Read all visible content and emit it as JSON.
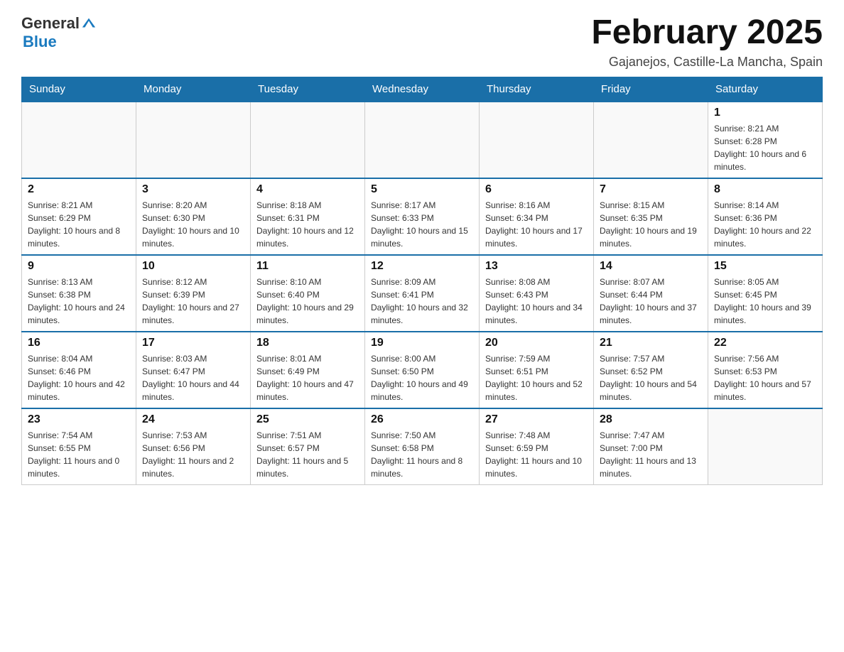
{
  "header": {
    "logo_general": "General",
    "logo_blue": "Blue",
    "month_title": "February 2025",
    "location": "Gajanejos, Castille-La Mancha, Spain"
  },
  "days_of_week": [
    "Sunday",
    "Monday",
    "Tuesday",
    "Wednesday",
    "Thursday",
    "Friday",
    "Saturday"
  ],
  "weeks": [
    {
      "days": [
        {
          "date": "",
          "info": ""
        },
        {
          "date": "",
          "info": ""
        },
        {
          "date": "",
          "info": ""
        },
        {
          "date": "",
          "info": ""
        },
        {
          "date": "",
          "info": ""
        },
        {
          "date": "",
          "info": ""
        },
        {
          "date": "1",
          "info": "Sunrise: 8:21 AM\nSunset: 6:28 PM\nDaylight: 10 hours and 6 minutes."
        }
      ]
    },
    {
      "days": [
        {
          "date": "2",
          "info": "Sunrise: 8:21 AM\nSunset: 6:29 PM\nDaylight: 10 hours and 8 minutes."
        },
        {
          "date": "3",
          "info": "Sunrise: 8:20 AM\nSunset: 6:30 PM\nDaylight: 10 hours and 10 minutes."
        },
        {
          "date": "4",
          "info": "Sunrise: 8:18 AM\nSunset: 6:31 PM\nDaylight: 10 hours and 12 minutes."
        },
        {
          "date": "5",
          "info": "Sunrise: 8:17 AM\nSunset: 6:33 PM\nDaylight: 10 hours and 15 minutes."
        },
        {
          "date": "6",
          "info": "Sunrise: 8:16 AM\nSunset: 6:34 PM\nDaylight: 10 hours and 17 minutes."
        },
        {
          "date": "7",
          "info": "Sunrise: 8:15 AM\nSunset: 6:35 PM\nDaylight: 10 hours and 19 minutes."
        },
        {
          "date": "8",
          "info": "Sunrise: 8:14 AM\nSunset: 6:36 PM\nDaylight: 10 hours and 22 minutes."
        }
      ]
    },
    {
      "days": [
        {
          "date": "9",
          "info": "Sunrise: 8:13 AM\nSunset: 6:38 PM\nDaylight: 10 hours and 24 minutes."
        },
        {
          "date": "10",
          "info": "Sunrise: 8:12 AM\nSunset: 6:39 PM\nDaylight: 10 hours and 27 minutes."
        },
        {
          "date": "11",
          "info": "Sunrise: 8:10 AM\nSunset: 6:40 PM\nDaylight: 10 hours and 29 minutes."
        },
        {
          "date": "12",
          "info": "Sunrise: 8:09 AM\nSunset: 6:41 PM\nDaylight: 10 hours and 32 minutes."
        },
        {
          "date": "13",
          "info": "Sunrise: 8:08 AM\nSunset: 6:43 PM\nDaylight: 10 hours and 34 minutes."
        },
        {
          "date": "14",
          "info": "Sunrise: 8:07 AM\nSunset: 6:44 PM\nDaylight: 10 hours and 37 minutes."
        },
        {
          "date": "15",
          "info": "Sunrise: 8:05 AM\nSunset: 6:45 PM\nDaylight: 10 hours and 39 minutes."
        }
      ]
    },
    {
      "days": [
        {
          "date": "16",
          "info": "Sunrise: 8:04 AM\nSunset: 6:46 PM\nDaylight: 10 hours and 42 minutes."
        },
        {
          "date": "17",
          "info": "Sunrise: 8:03 AM\nSunset: 6:47 PM\nDaylight: 10 hours and 44 minutes."
        },
        {
          "date": "18",
          "info": "Sunrise: 8:01 AM\nSunset: 6:49 PM\nDaylight: 10 hours and 47 minutes."
        },
        {
          "date": "19",
          "info": "Sunrise: 8:00 AM\nSunset: 6:50 PM\nDaylight: 10 hours and 49 minutes."
        },
        {
          "date": "20",
          "info": "Sunrise: 7:59 AM\nSunset: 6:51 PM\nDaylight: 10 hours and 52 minutes."
        },
        {
          "date": "21",
          "info": "Sunrise: 7:57 AM\nSunset: 6:52 PM\nDaylight: 10 hours and 54 minutes."
        },
        {
          "date": "22",
          "info": "Sunrise: 7:56 AM\nSunset: 6:53 PM\nDaylight: 10 hours and 57 minutes."
        }
      ]
    },
    {
      "days": [
        {
          "date": "23",
          "info": "Sunrise: 7:54 AM\nSunset: 6:55 PM\nDaylight: 11 hours and 0 minutes."
        },
        {
          "date": "24",
          "info": "Sunrise: 7:53 AM\nSunset: 6:56 PM\nDaylight: 11 hours and 2 minutes."
        },
        {
          "date": "25",
          "info": "Sunrise: 7:51 AM\nSunset: 6:57 PM\nDaylight: 11 hours and 5 minutes."
        },
        {
          "date": "26",
          "info": "Sunrise: 7:50 AM\nSunset: 6:58 PM\nDaylight: 11 hours and 8 minutes."
        },
        {
          "date": "27",
          "info": "Sunrise: 7:48 AM\nSunset: 6:59 PM\nDaylight: 11 hours and 10 minutes."
        },
        {
          "date": "28",
          "info": "Sunrise: 7:47 AM\nSunset: 7:00 PM\nDaylight: 11 hours and 13 minutes."
        },
        {
          "date": "",
          "info": ""
        }
      ]
    }
  ]
}
